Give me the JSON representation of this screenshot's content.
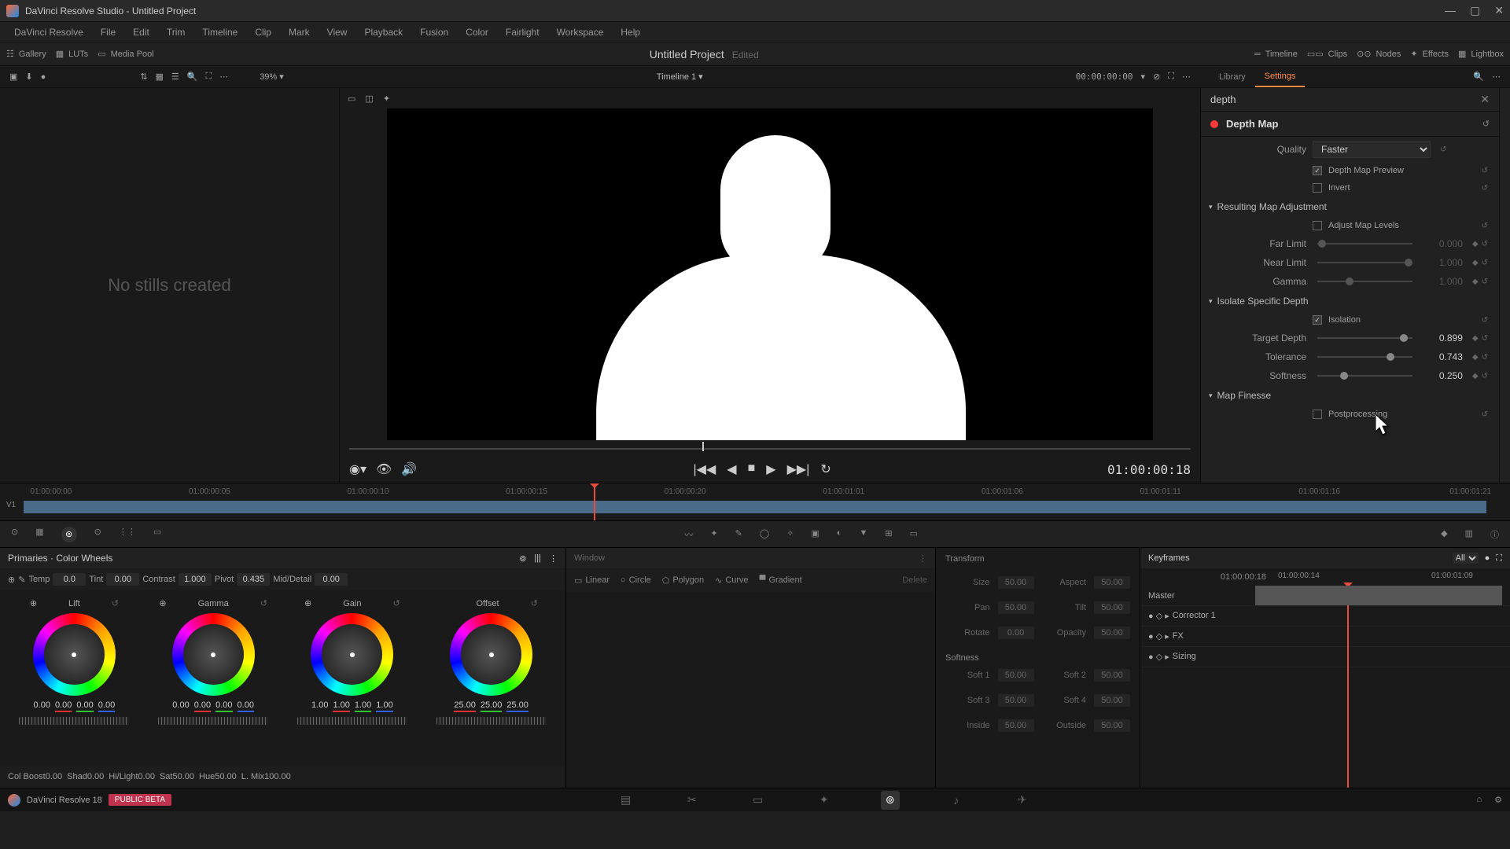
{
  "window": {
    "title": "DaVinci Resolve Studio - Untitled Project"
  },
  "menubar": [
    "DaVinci Resolve",
    "File",
    "Edit",
    "Trim",
    "Timeline",
    "Clip",
    "Mark",
    "View",
    "Playback",
    "Fusion",
    "Color",
    "Fairlight",
    "Workspace",
    "Help"
  ],
  "toolbar": {
    "gallery": "Gallery",
    "luts": "LUTs",
    "mediapool": "Media Pool",
    "project": "Untitled Project",
    "edited": "Edited",
    "timeline": "Timeline",
    "clips": "Clips",
    "nodes": "Nodes",
    "effects": "Effects",
    "lightbox": "Lightbox"
  },
  "viewerbar": {
    "zoom": "39%",
    "timeline_name": "Timeline 1",
    "tc": "00:00:00:00"
  },
  "gallery": {
    "empty": "No stills created"
  },
  "settings": {
    "tabs": {
      "library": "Library",
      "settings": "Settings"
    },
    "search": "depth",
    "effect_name": "Depth Map",
    "quality_label": "Quality",
    "quality_value": "Faster",
    "preview_label": "Depth Map Preview",
    "invert_label": "Invert",
    "map_adjust": "Resulting Map Adjustment",
    "adjust_levels": "Adjust Map Levels",
    "far_limit": {
      "label": "Far Limit",
      "value": "0.000"
    },
    "near_limit": {
      "label": "Near Limit",
      "value": "1.000"
    },
    "gamma": {
      "label": "Gamma",
      "value": "1.000"
    },
    "isolate": "Isolate Specific Depth",
    "isolation_label": "Isolation",
    "target_depth": {
      "label": "Target Depth",
      "value": "0.899"
    },
    "tolerance": {
      "label": "Tolerance",
      "value": "0.743"
    },
    "softness": {
      "label": "Softness",
      "value": "0.250"
    },
    "map_finesse": "Map Finesse",
    "postprocessing": "Postprocessing"
  },
  "transport": {
    "tc": "01:00:00:18"
  },
  "timeline": {
    "ticks": [
      "01:00:00:00",
      "01:00:00:05",
      "01:00:00:10",
      "01:00:00:15",
      "01:00:00:20",
      "01:00:01:01",
      "01:00:01:06",
      "01:00:01:11",
      "01:00:01:16",
      "01:00:01:21"
    ],
    "track": "V1"
  },
  "primaries": {
    "title": "Primaries · Color Wheels",
    "temp": {
      "label": "Temp",
      "value": "0.0"
    },
    "tint": {
      "label": "Tint",
      "value": "0.00"
    },
    "contrast": {
      "label": "Contrast",
      "value": "1.000"
    },
    "pivot": {
      "label": "Pivot",
      "value": "0.435"
    },
    "middetail": {
      "label": "Mid/Detail",
      "value": "0.00"
    },
    "wheels": [
      {
        "name": "Lift",
        "vals": [
          "0.00",
          "0.00",
          "0.00",
          "0.00"
        ]
      },
      {
        "name": "Gamma",
        "vals": [
          "0.00",
          "0.00",
          "0.00",
          "0.00"
        ]
      },
      {
        "name": "Gain",
        "vals": [
          "1.00",
          "1.00",
          "1.00",
          "1.00"
        ]
      },
      {
        "name": "Offset",
        "vals": [
          "25.00",
          "25.00",
          "25.00"
        ]
      }
    ],
    "bottom": {
      "colboost": {
        "label": "Col Boost",
        "value": "0.00"
      },
      "shad": {
        "label": "Shad",
        "value": "0.00"
      },
      "hilight": {
        "label": "Hi/Light",
        "value": "0.00"
      },
      "sat": {
        "label": "Sat",
        "value": "50.00"
      },
      "hue": {
        "label": "Hue",
        "value": "50.00"
      },
      "lmix": {
        "label": "L. Mix",
        "value": "100.00"
      }
    }
  },
  "window_panel": {
    "title": "Window",
    "shapes": [
      "Linear",
      "Circle",
      "Polygon",
      "Curve",
      "Gradient"
    ],
    "delete": "Delete"
  },
  "transform": {
    "title": "Transform",
    "size": {
      "label": "Size",
      "value": "50.00"
    },
    "aspect": {
      "label": "Aspect",
      "value": "50.00"
    },
    "pan": {
      "label": "Pan",
      "value": "50.00"
    },
    "tilt": {
      "label": "Tilt",
      "value": "50.00"
    },
    "rotate": {
      "label": "Rotate",
      "value": "0.00"
    },
    "opacity": {
      "label": "Opacity",
      "value": "50.00"
    },
    "softness_title": "Softness",
    "soft1": {
      "label": "Soft 1",
      "value": "50.00"
    },
    "soft2": {
      "label": "Soft 2",
      "value": "50.00"
    },
    "soft3": {
      "label": "Soft 3",
      "value": "50.00"
    },
    "soft4": {
      "label": "Soft 4",
      "value": "50.00"
    },
    "inside": {
      "label": "Inside",
      "value": "50.00"
    },
    "outside": {
      "label": "Outside",
      "value": "50.00"
    }
  },
  "keyframes": {
    "title": "Keyframes",
    "filter": "All",
    "tc": "01:00:00:18",
    "ticks": [
      "01:00:00:14",
      "01:00:01:09"
    ],
    "rows": [
      "Master",
      "Corrector 1",
      "FX",
      "Sizing"
    ]
  },
  "footer": {
    "app": "DaVinci Resolve 18",
    "badge": "PUBLIC BETA"
  }
}
